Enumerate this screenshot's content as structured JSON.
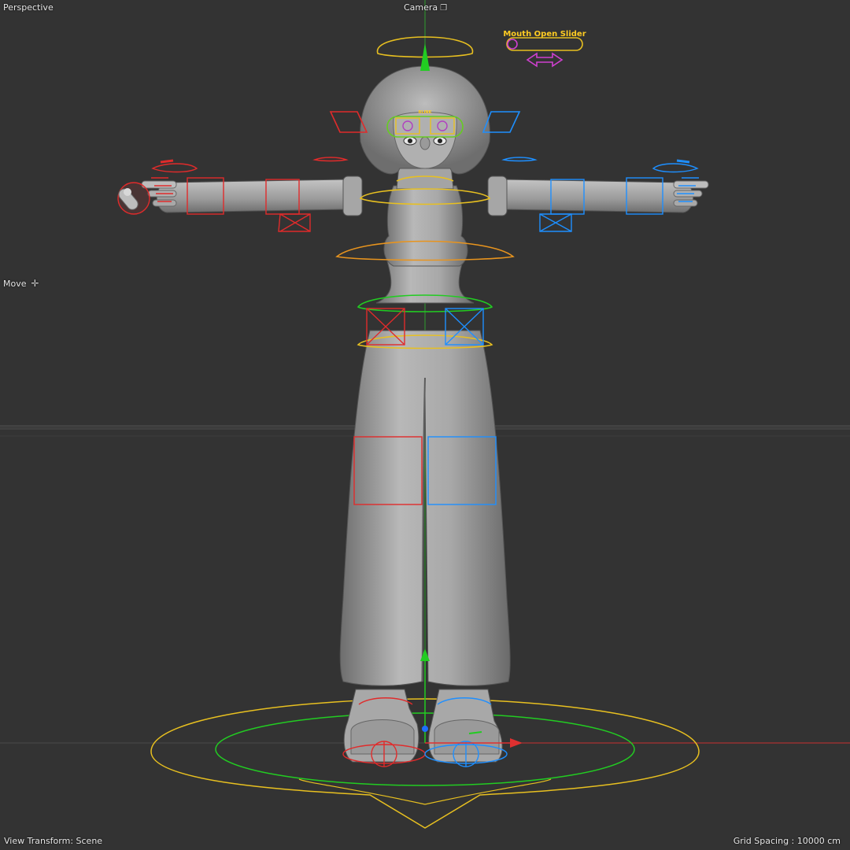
{
  "viewport": {
    "name": "Perspective",
    "camera_label": "Camera",
    "camera_icon": "camera-settings-icon",
    "tool_label": "Move",
    "tool_icon": "move-cross-icon",
    "view_transform": "View Transform: Scene",
    "grid_spacing": "Grid Spacing : 10000 cm"
  },
  "rig_ui": {
    "mouth_slider_label": "Mouth Open Slider",
    "mouth_slider_value": 0,
    "blink_label": "BLINK"
  },
  "colors": {
    "background": "#333333",
    "left_controls": "#e02b2b",
    "right_controls": "#1e8fff",
    "center_controls": "#f0c020",
    "hip_controls": "#22cc22",
    "root_controls": "#f0c020",
    "eye_controls": "#b040c0",
    "model": "#9c9c9c",
    "axis_x": "#e03030",
    "axis_y": "#30c030"
  }
}
